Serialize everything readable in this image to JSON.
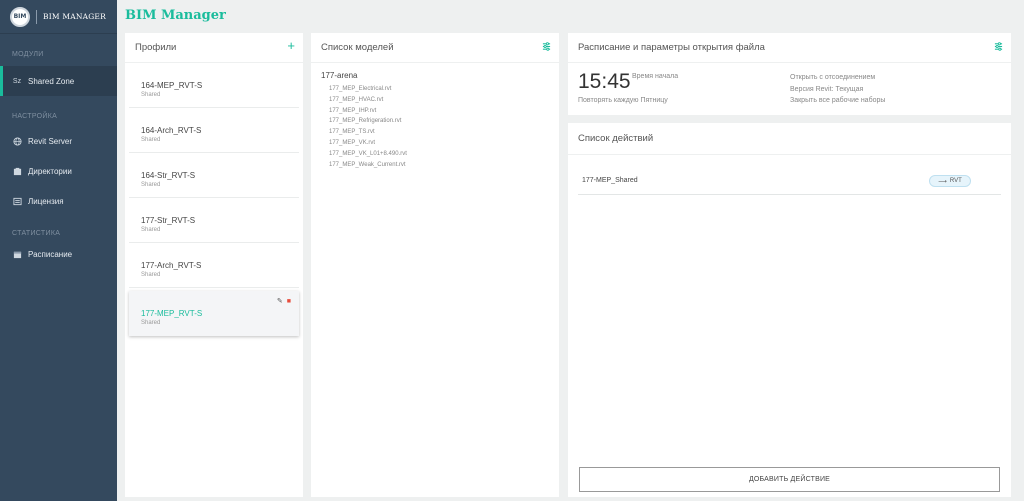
{
  "brand": {
    "logo_text": "BIM",
    "name": "BIM MANAGER"
  },
  "sidebar": {
    "sections": [
      {
        "label": "МОДУЛИ",
        "items": [
          {
            "label": "Shared Zone",
            "icon": "sz-icon",
            "icon_text": "Sz",
            "active": true
          }
        ]
      },
      {
        "label": "НАСТРОЙКА",
        "items": [
          {
            "label": "Revit Server",
            "icon": "globe-icon",
            "active": false
          },
          {
            "label": "Директории",
            "icon": "folder-icon",
            "active": false
          },
          {
            "label": "Лицензия",
            "icon": "license-icon",
            "active": false
          }
        ]
      },
      {
        "label": "СТАТИСТИКА",
        "items": [
          {
            "label": "Расписание",
            "icon": "schedule-icon",
            "active": false
          }
        ]
      }
    ]
  },
  "header": {
    "title": "BIM Manager"
  },
  "profiles": {
    "title": "Профили",
    "add_icon": "plus-icon",
    "items": [
      {
        "name": "164-MEP_RVT-S",
        "sub": "Shared"
      },
      {
        "name": "164-Arch_RVT-S",
        "sub": "Shared"
      },
      {
        "name": "164-Str_RVT-S",
        "sub": "Shared"
      },
      {
        "name": "177-Str_RVT-S",
        "sub": "Shared"
      },
      {
        "name": "177-Arch_RVT-S",
        "sub": "Shared"
      },
      {
        "name": "177-MEP_RVT-S",
        "sub": "Shared",
        "active": true
      }
    ]
  },
  "models": {
    "title": "Список моделей",
    "group": "177-arena",
    "files": [
      "177_MEP_Electrical.rvt",
      "177_MEP_HVAC.rvt",
      "177_MEP_IHP.rvt",
      "177_MEP_Refrigeration.rvt",
      "177_MEP_TS.rvt",
      "177_MEP_VK.rvt",
      "177_MEP_VK_L01+8.490.rvt",
      "177_MEP_Weak_Current.rvt"
    ]
  },
  "schedule": {
    "title": "Расписание и параметры открытия файла",
    "time": "15:45",
    "time_label": "Время начала",
    "repeat": "Повторять каждую Пятницу",
    "detach": "Открыть с отсоединением",
    "version": "Версия Revit: Текущая",
    "close_worksets": "Закрыть все рабочие наборы"
  },
  "actions": {
    "title": "Список действий",
    "rows": [
      {
        "name": "177-MEP_Shared",
        "badge": "RVT"
      }
    ],
    "add_label": "ДОБАВИТЬ ДЕЙСТВИЕ"
  },
  "colors": {
    "accent": "#1abc9c",
    "sidebar": "#34495e",
    "danger": "#e74c3c"
  }
}
